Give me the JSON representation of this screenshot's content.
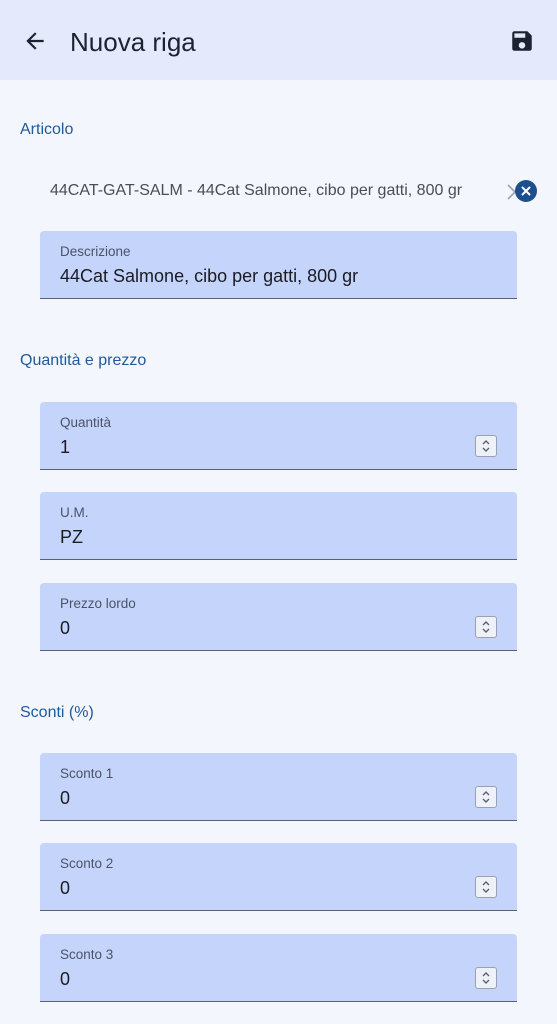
{
  "appbar": {
    "title": "Nuova riga",
    "back_icon": "arrow-left-icon",
    "save_icon": "floppy-disk-icon"
  },
  "sections": {
    "articolo": "Articolo",
    "quantita_prezzo": "Quantità e prezzo",
    "sconti": "Sconti (%)"
  },
  "article": {
    "selected": "44CAT-GAT-SALM - 44Cat Salmone, cibo per gatti, 800 gr",
    "chevron_icon": "chevron-right-icon",
    "clear_icon": "close-circle-icon"
  },
  "fields": {
    "descrizione": {
      "label": "Descrizione",
      "value": "44Cat Salmone, cibo per gatti, 800 gr"
    },
    "quantita": {
      "label": "Quantità",
      "value": "1"
    },
    "um": {
      "label": "U.M.",
      "value": "PZ"
    },
    "prezzo_lordo": {
      "label": "Prezzo lordo",
      "value": "0"
    },
    "sconto1": {
      "label": "Sconto 1",
      "value": "0"
    },
    "sconto2": {
      "label": "Sconto 2",
      "value": "0"
    },
    "sconto3": {
      "label": "Sconto 3",
      "value": "0"
    }
  },
  "colors": {
    "appbar_bg": "#e4e9fb",
    "page_bg": "#f4f6fe",
    "field_bg": "#c5d4fb",
    "section_title": "#1e5a99",
    "clear_button": "#1c4f8c"
  }
}
